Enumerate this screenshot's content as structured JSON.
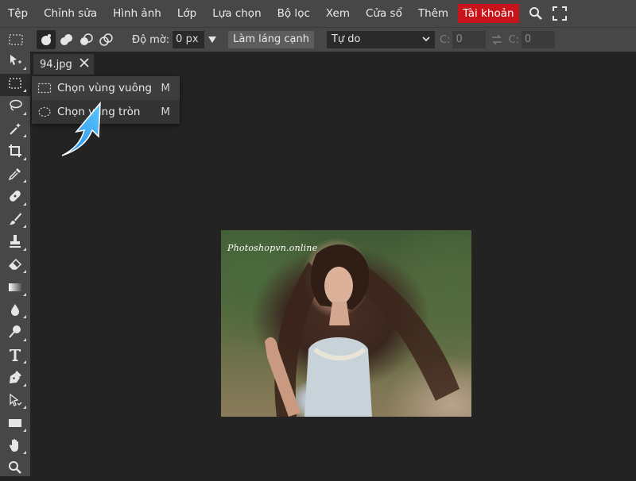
{
  "menu": {
    "items": [
      "Tệp",
      "Chỉnh sửa",
      "Hình ảnh",
      "Lớp",
      "Lựa chọn",
      "Bộ lọc",
      "Xem",
      "Cửa sổ",
      "Thêm"
    ],
    "account": "Tài khoản",
    "account_color": "#c7141a"
  },
  "options": {
    "feather_label": "Độ mờ:",
    "feather_value": "0 px",
    "smooth_button": "Làm láng cạnh",
    "style_value": "Tự do",
    "width_label": "C:",
    "width_value": "0",
    "height_label": "C:",
    "height_value": "0"
  },
  "document": {
    "tab_title": "94.jpg",
    "watermark": "Photoshopvn.online"
  },
  "flyout": {
    "items": [
      {
        "label": "Chọn vùng vuông",
        "shortcut": "M",
        "icon": "rect-marquee-icon"
      },
      {
        "label": "Chọn vùng tròn",
        "shortcut": "M",
        "icon": "ellipse-marquee-icon"
      }
    ]
  },
  "toolbar": {
    "tools": [
      "move-icon",
      "rect-select-icon",
      "lasso-icon",
      "magic-wand-icon",
      "crop-icon",
      "eyedropper-icon",
      "healing-icon",
      "brush-icon",
      "stamp-icon",
      "eraser-icon",
      "gradient-icon",
      "blur-icon",
      "dodge-icon",
      "text-icon",
      "pen-icon",
      "path-select-icon",
      "shape-icon",
      "hand-icon",
      "zoom-icon"
    ]
  }
}
